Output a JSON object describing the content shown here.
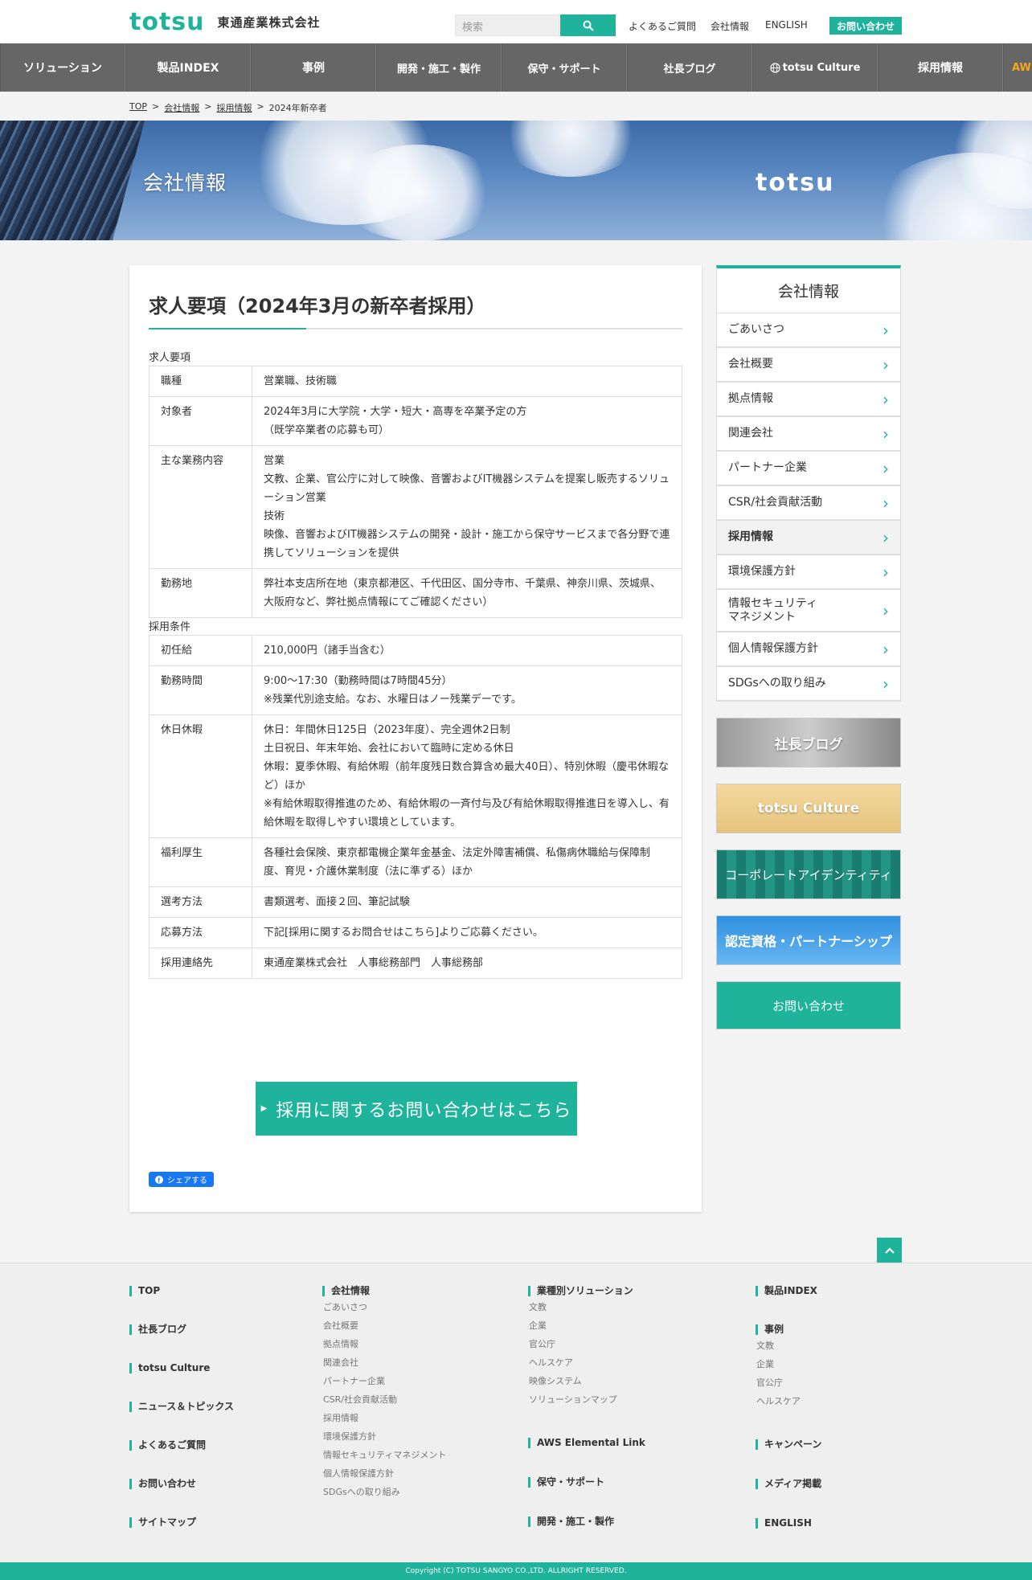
{
  "header": {
    "logo_mark": "totsu",
    "company_name": "東通産業株式会社",
    "search_placeholder": "検索",
    "util_nav": [
      "よくあるご質問",
      "会社情報",
      "ENGLISH"
    ],
    "contact_label": "お問い合わせ",
    "accent_color": "#1fb39c"
  },
  "gnav": {
    "items": [
      "ソリューション",
      "製品INDEX",
      "事例",
      "開発・施工・製作",
      "保守・サポート",
      "社長ブログ",
      "totsu Culture",
      "採用情報",
      "AWS"
    ]
  },
  "breadcrumb": {
    "items": [
      "TOP",
      "会社情報",
      "採用情報",
      "2024年新卒者"
    ]
  },
  "hero": {
    "title": "会社情報",
    "logo": "totsu"
  },
  "main": {
    "title": "求人要項（2024年3月の新卒者採用）",
    "section1_caption": "求人要項",
    "section1_rows": [
      {
        "label": "職種",
        "lines": [
          "営業職、技術職"
        ]
      },
      {
        "label": "対象者",
        "lines": [
          "2024年3月に大学院・大学・短大・高専を卒業予定の方",
          "（既学卒業者の応募も可）"
        ]
      },
      {
        "label": "主な業務内容",
        "lines": [
          "営業",
          "文教、企業、官公庁に対して映像、音響およびIT機器システムを提案し販売するソリューション営業",
          "技術",
          "映像、音響およびIT機器システムの開発・設計・施工から保守サービスまで各分野で連携してソリューションを提供"
        ]
      },
      {
        "label": "勤務地",
        "lines": [
          "弊社本支店所在地（東京都港区、千代田区、国分寺市、千葉県、神奈川県、茨城県、大阪府など、弊社拠点情報にてご確認ください）"
        ]
      }
    ],
    "section2_caption": "採用条件",
    "section2_rows": [
      {
        "label": "初任給",
        "lines": [
          "210,000円（諸手当含む）"
        ]
      },
      {
        "label": "勤務時間",
        "lines": [
          "9:00～17:30（勤務時間は7時間45分）",
          "※残業代別途支給。なお、水曜日はノー残業デーです。"
        ]
      },
      {
        "label": "休日休暇",
        "lines": [
          "休日：年間休日125日（2023年度）、完全週休2日制",
          "土日祝日、年末年始、会社において臨時に定める休日",
          "休暇：夏季休暇、有給休暇（前年度残日数合算含め最大40日）、特別休暇（慶弔休暇など）ほか",
          "※有給休暇取得推進のため、有給休暇の一斉付与及び有給休暇取得推進日を導入し、有給休暇を取得しやすい環境としています。"
        ]
      },
      {
        "label": "福利厚生",
        "lines": [
          "各種社会保険、東京都電機企業年金基金、法定外障害補償、私傷病休職給与保障制度、育児・介護休業制度（法に準ずる）ほか"
        ]
      },
      {
        "label": "選考方法",
        "lines": [
          "書類選考、面接２回、筆記試験"
        ]
      },
      {
        "label": "応募方法",
        "lines": [
          "下記[採用に関するお問合せはこちら]よりご応募ください。"
        ]
      },
      {
        "label": "採用連絡先",
        "lines": [
          "東通産業株式会社　人事総務部門　人事総務部"
        ]
      }
    ],
    "cta_label": "採用に関するお問い合わせはこちら",
    "share_label": "シェアする"
  },
  "sidebar": {
    "title": "会社情報",
    "items": [
      "ごあいさつ",
      "会社概要",
      "拠点情報",
      "関連会社",
      "パートナー企業",
      "CSR/社会貢献活動",
      "採用情報",
      "環境保護方針",
      "情報セキュリティ\nマネジメント",
      "個人情報保護方針",
      "SDGsへの取り組み"
    ],
    "active_index": 6,
    "banners": [
      "社長ブログ",
      "totsu Culture",
      "コーポレートアイデンティティ",
      "認定資格・パートナーシップ"
    ],
    "contact_label": "お問い合わせ"
  },
  "footer": {
    "col1": [
      "TOP",
      "社長ブログ",
      "totsu Culture",
      "ニュース＆トピックス",
      "よくあるご質問",
      "お問い合わせ",
      "サイトマップ"
    ],
    "col2": {
      "head": "会社情報",
      "links": [
        "ごあいさつ",
        "会社概要",
        "拠点情報",
        "関連会社",
        "パートナー企業",
        "CSR/社会貢献活動",
        "採用情報",
        "環境保護方針",
        "情報セキュリティマネジメント",
        "個人情報保護方針",
        "SDGsへの取り組み"
      ]
    },
    "col3": {
      "head": "業種別ソリューション",
      "links": [
        "文教",
        "企業",
        "官公庁",
        "ヘルスケア",
        "映像システム",
        "ソリューションマップ"
      ],
      "extra": [
        "AWS Elemental Link",
        "保守・サポート",
        "開発・施工・製作"
      ]
    },
    "col4": {
      "head1": "製品INDEX",
      "head2": "事例",
      "links": [
        "文教",
        "企業",
        "官公庁",
        "ヘルスケア"
      ],
      "extra": [
        "キャンペーン",
        "メディア掲載",
        "ENGLISH"
      ]
    },
    "copyright": "Copyright (C) TOTSU SANGYO CO.,LTD. ALLRIGHT RESERVED."
  }
}
